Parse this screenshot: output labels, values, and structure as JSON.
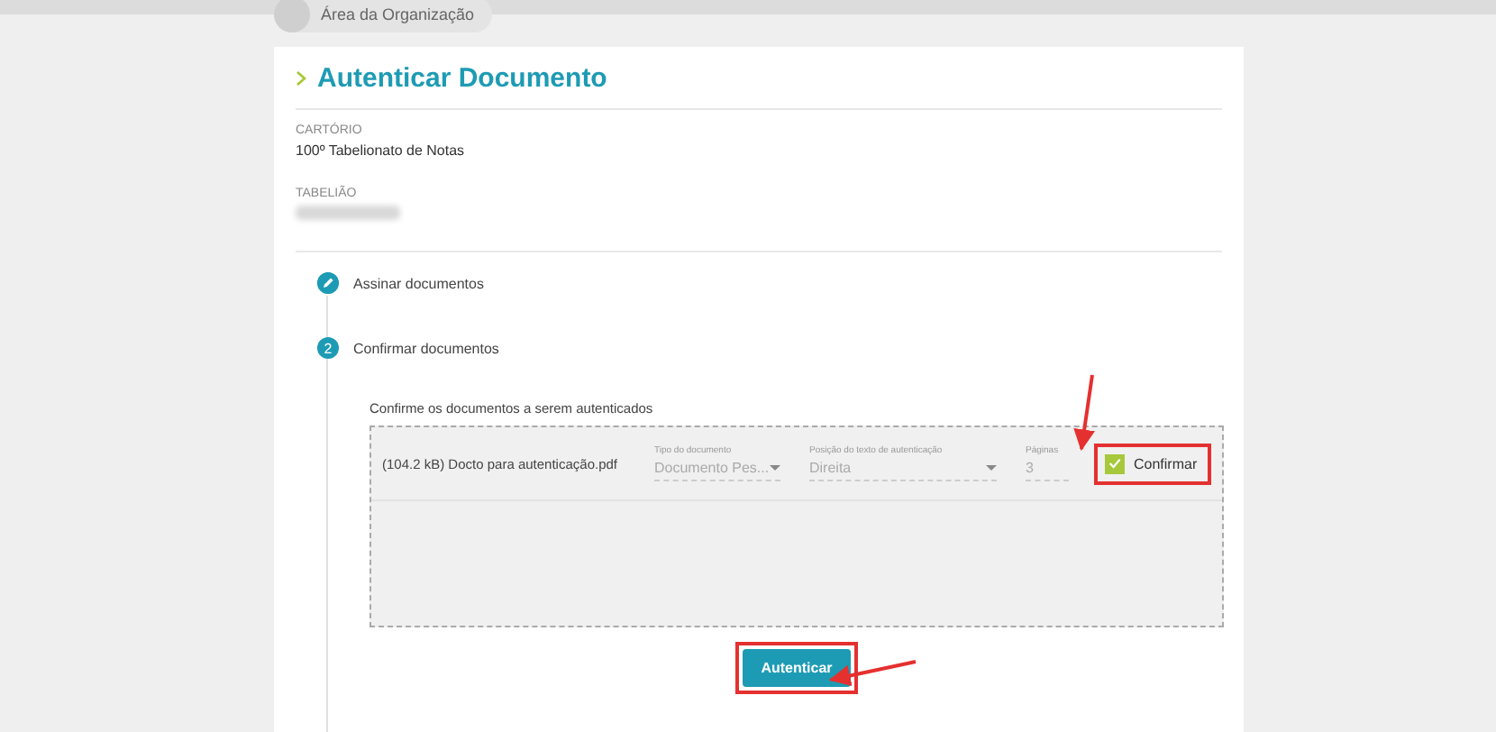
{
  "breadcrumb": {
    "label": "Área da Organização"
  },
  "page_title": "Autenticar Documento",
  "fields": [
    {
      "label": "CARTÓRIO",
      "value": "100º Tabelionato de Notas",
      "blurred": false
    },
    {
      "label": "TABELIÃO",
      "blurred": true
    }
  ],
  "steps": [
    {
      "kind": "done",
      "label": "Assinar documentos"
    },
    {
      "kind": "active",
      "marker": "2",
      "label": "Confirmar documentos"
    }
  ],
  "instruction": "Confirme os documentos a serem autenticados",
  "documents": [
    {
      "name": "(104.2 kB) Docto para autenticação.pdf",
      "type_label": "Tipo do documento",
      "type_value": "Documento Pes...",
      "position_label": "Posição do texto de autenticação",
      "position_value": "Direita",
      "pages_label": "Páginas",
      "pages_value": "3",
      "confirm_label": "Confirmar",
      "checked": true
    }
  ],
  "submit_button": "Autenticar"
}
